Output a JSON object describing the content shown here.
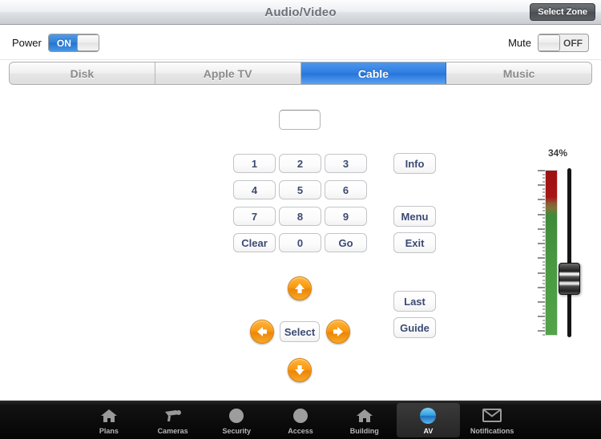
{
  "titlebar": {
    "title": "Audio/Video",
    "select_zone_label": "Select Zone"
  },
  "controls": {
    "power_label": "Power",
    "power_state": "ON",
    "power_on_text": "ON",
    "mute_label": "Mute",
    "mute_state": "OFF",
    "mute_off_text": "OFF",
    "device_name_redacted": ""
  },
  "sources": {
    "selected": "Cable",
    "items": [
      {
        "label": "Disk",
        "active": false
      },
      {
        "label": "Apple TV",
        "active": false
      },
      {
        "label": "Cable",
        "active": true
      },
      {
        "label": "Music",
        "active": false
      }
    ]
  },
  "remote": {
    "display_value": "",
    "keypad": [
      {
        "label": "1"
      },
      {
        "label": "2"
      },
      {
        "label": "3"
      },
      {
        "label": "4"
      },
      {
        "label": "5"
      },
      {
        "label": "6"
      },
      {
        "label": "7"
      },
      {
        "label": "8"
      },
      {
        "label": "9"
      },
      {
        "label": "Clear"
      },
      {
        "label": "0"
      },
      {
        "label": "Go"
      }
    ],
    "function_buttons": [
      {
        "label": "Info"
      },
      {
        "label": "Menu"
      },
      {
        "label": "Exit"
      },
      {
        "label": "Last"
      },
      {
        "label": "Guide"
      }
    ],
    "dpad": {
      "up": "up-arrow",
      "down": "down-arrow",
      "left": "left-arrow",
      "right": "right-arrow",
      "center_label": "Select"
    }
  },
  "volume": {
    "percent_label": "34%",
    "percent_value": 34,
    "meter_colors": {
      "high": "#a31313",
      "mid": "#7f7335",
      "low": "#4a9a42"
    }
  },
  "tabbar": {
    "selected": "AV",
    "items": [
      {
        "label": "Plans",
        "icon": "house-icon",
        "active": false
      },
      {
        "label": "Cameras",
        "icon": "camera-icon",
        "active": false
      },
      {
        "label": "Security",
        "icon": "circle-icon",
        "active": false
      },
      {
        "label": "Access",
        "icon": "circle-icon",
        "active": false
      },
      {
        "label": "Building",
        "icon": "house-icon",
        "active": false
      },
      {
        "label": "AV",
        "icon": "av-sphere-icon",
        "active": true
      },
      {
        "label": "Notifications",
        "icon": "envelope-icon",
        "active": false
      }
    ]
  },
  "colors": {
    "accent_blue": "#2f7de1",
    "accent_orange": "#f2960e",
    "button_text": "#3c4a73"
  }
}
